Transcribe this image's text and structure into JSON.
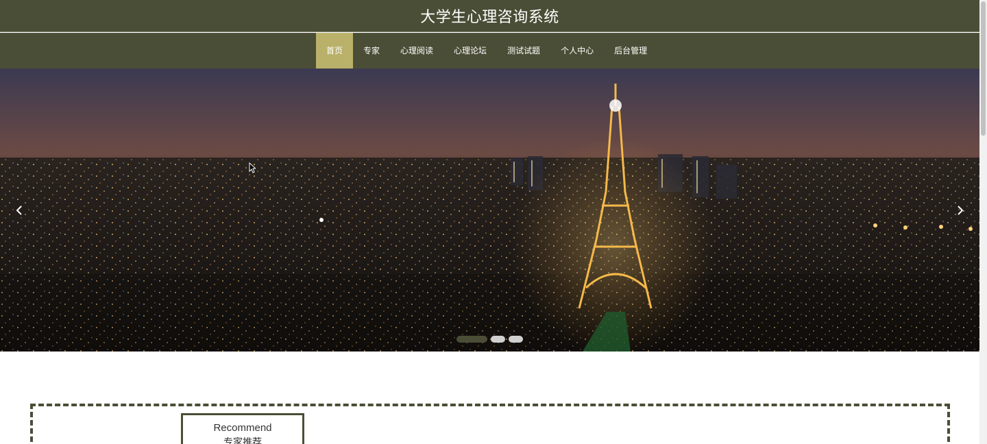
{
  "header": {
    "title": "大学生心理咨询系统"
  },
  "nav": {
    "items": [
      {
        "label": "首页",
        "active": true
      },
      {
        "label": "专家",
        "active": false
      },
      {
        "label": "心理阅读",
        "active": false
      },
      {
        "label": "心理论坛",
        "active": false
      },
      {
        "label": "测试试题",
        "active": false
      },
      {
        "label": "个人中心",
        "active": false
      },
      {
        "label": "后台管理",
        "active": false
      }
    ]
  },
  "carousel": {
    "slide_count": 3,
    "active_index": 0,
    "prev_icon": "chevron-left-icon",
    "next_icon": "chevron-right-icon"
  },
  "recommend": {
    "title_en": "Recommend",
    "title_cn": "专家推荐"
  },
  "colors": {
    "primary": "#4b4e36",
    "accent": "#b9b06a",
    "background": "#ffffff"
  }
}
